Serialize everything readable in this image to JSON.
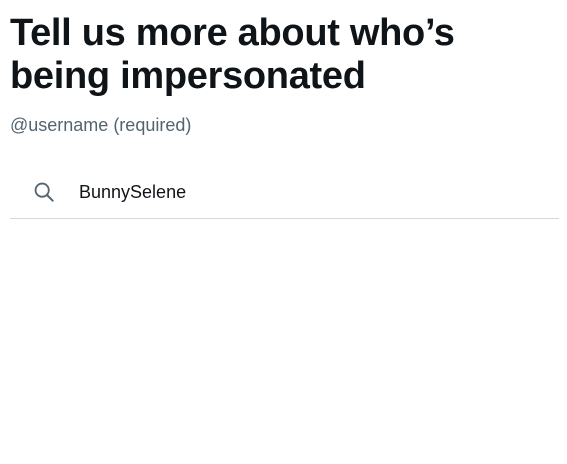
{
  "page": {
    "title": "Tell us more about who’s being impersonated",
    "subtitle": "@username (required)"
  },
  "search": {
    "icon": "search-icon",
    "value": "BunnySelene",
    "placeholder": ""
  },
  "colors": {
    "text_primary": "#0f1419",
    "text_secondary": "#536471",
    "divider": "#cfd9de",
    "icon": "#536471"
  }
}
